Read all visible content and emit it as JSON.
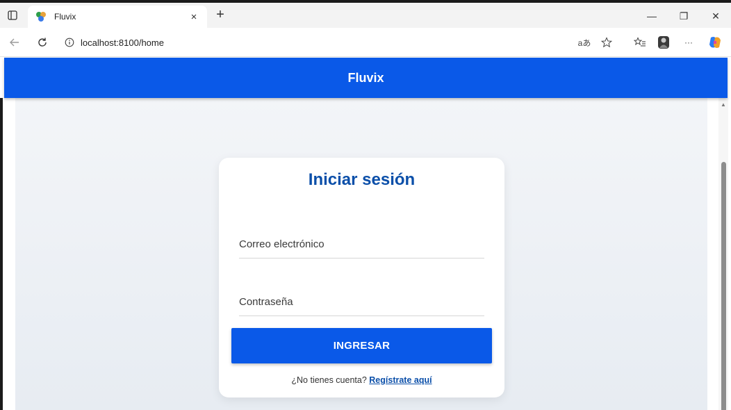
{
  "browser": {
    "tab": {
      "title": "Fluvix",
      "close": "×"
    },
    "new_tab": "+",
    "window": {
      "minimize": "—",
      "restore": "❐",
      "close": "✕"
    },
    "address": {
      "url": "localhost:8100/home"
    },
    "tools": {
      "read_aloud": "aあ",
      "more": "···"
    }
  },
  "app": {
    "header_title": "Fluvix",
    "login": {
      "title": "Iniciar sesión",
      "email_placeholder": "Correo electrónico",
      "email_value": "",
      "password_placeholder": "Contraseña",
      "password_value": "",
      "submit_label": "INGRESAR",
      "register_prompt": "¿No tienes cuenta?",
      "register_link": "Regístrate aquí"
    }
  },
  "colors": {
    "primary": "#0a59e8",
    "title": "#0b4fa9",
    "background": "#eef1f5"
  },
  "icons": [
    "tab-actions-icon",
    "app-favicon-icon",
    "back-arrow-icon",
    "refresh-icon",
    "info-icon",
    "favorite-star-icon",
    "favorites-list-icon",
    "profile-avatar-icon",
    "copilot-icon",
    "scroll-up-arrow-icon"
  ]
}
